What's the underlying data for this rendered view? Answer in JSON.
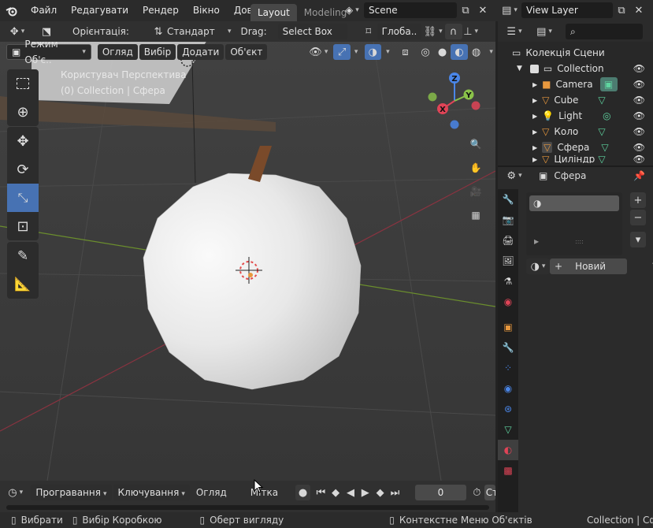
{
  "menu": {
    "items": [
      "Файл",
      "Редагувати",
      "Рендер",
      "Вікно",
      "Довідка"
    ],
    "workspaces": [
      "Layout",
      "Modeling"
    ],
    "scene": "Scene",
    "view_layer": "View Layer"
  },
  "header": {
    "orientation_label": "Орієнтація:",
    "orientation_value": "Стандарт",
    "drag_label": "Drag:",
    "drag_value": "Select Box",
    "transform_value": "Глоба.."
  },
  "viewport_header": {
    "mode": "Режим Об'є..",
    "menus": [
      "Огляд",
      "Вибір",
      "Додати",
      "Об'єкт"
    ]
  },
  "viewport": {
    "view_name": "Користувач Перспектива",
    "object_info": "(0) Collection | Сфера",
    "axis_labels": {
      "z": "Z",
      "y": "Y",
      "x": "X"
    }
  },
  "outliner": {
    "root": "Колекція Сцени",
    "collection": "Collection",
    "items": [
      {
        "name": "Camera",
        "icon": "camera-icon"
      },
      {
        "name": "Cube",
        "icon": "mesh-icon"
      },
      {
        "name": "Light",
        "icon": "light-icon"
      },
      {
        "name": "Коло",
        "icon": "mesh-icon"
      },
      {
        "name": "Сфера",
        "icon": "mesh-icon"
      },
      {
        "name": "Циліндр",
        "icon": "mesh-icon"
      }
    ]
  },
  "properties": {
    "object_name": "Сфера",
    "new_label": "Новий"
  },
  "timeline": {
    "playback": "Програвання",
    "keying": "Ключування",
    "view": "Огляд",
    "marker": "Мітка",
    "current_frame": "0",
    "start_label": "Ст"
  },
  "statusbar": {
    "select": "Вибрати",
    "box_select": "Вибір Коробкою",
    "rotate_view": "Оберт вигляду",
    "context_menu": "Контекстне Меню Об'єктів",
    "info": "Collection | Сфера"
  },
  "colors": {
    "accent": "#4772b3",
    "mesh_green": "#5fd4a0",
    "axis_x": "#e04457",
    "axis_y": "#8bc34a",
    "axis_z": "#4a86e8"
  }
}
